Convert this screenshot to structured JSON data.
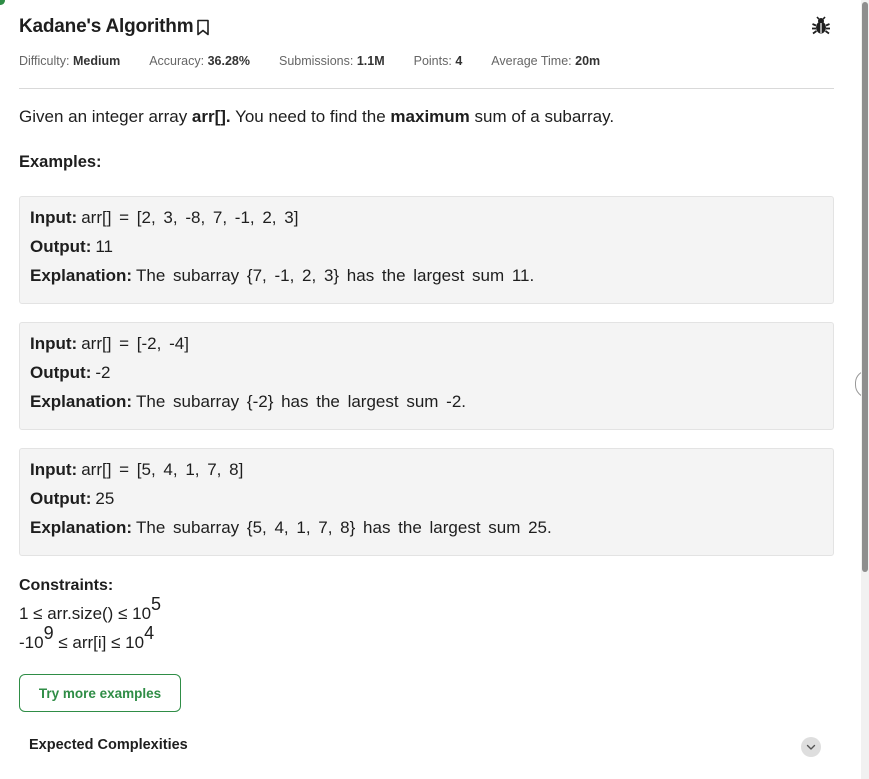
{
  "problem": {
    "title": "Kadane's Algorithm",
    "meta": [
      {
        "label": "Difficulty:",
        "value": "Medium"
      },
      {
        "label": "Accuracy:",
        "value": "36.28%"
      },
      {
        "label": "Submissions:",
        "value": "1.1M"
      },
      {
        "label": "Points:",
        "value": "4"
      },
      {
        "label": "Average Time:",
        "value": "20m"
      }
    ],
    "statement": {
      "p1": "Given an integer array ",
      "b1": "arr[].",
      "p2": " You need to find the ",
      "b2": "maximum",
      "p3": " sum of a subarray."
    },
    "examples_heading": "Examples:",
    "examples": [
      {
        "input_label": "Input:",
        "input": "arr[] = [2, 3, -8, 7, -1, 2, 3]",
        "output_label": "Output:",
        "output": "11",
        "explanation_label": "Explanation:",
        "explanation": "The subarray {7, -1, 2, 3} has the largest sum 11."
      },
      {
        "input_label": "Input:",
        "input": "arr[] = [-2, -4]",
        "output_label": "Output:",
        "output": "-2",
        "explanation_label": "Explanation:",
        "explanation": "The subarray {-2} has the largest sum -2."
      },
      {
        "input_label": "Input:",
        "input": "arr[] = [5, 4, 1, 7, 8]",
        "output_label": "Output:",
        "output": "25",
        "explanation_label": "Explanation:",
        "explanation": "The subarray {5, 4, 1, 7, 8} has the largest sum 25."
      }
    ],
    "constraints_heading": "Constraints:",
    "constraints": [
      {
        "pre": "1 ≤ arr.size() ≤ 10",
        "sup": "5",
        "post": ""
      },
      {
        "pre": "-10",
        "sup": "9",
        "post": " ≤ arr[i] ≤ 10",
        "sup2": "4"
      }
    ],
    "try_button": "Try more examples",
    "complexities_heading": "Expected Complexities"
  },
  "icons": {
    "bookmark": "bookmark-icon",
    "bug": "bug-icon",
    "chevron": "chevron-down-icon",
    "collapse": "collapse-left-icon"
  },
  "colors": {
    "accent": "#2f8d46",
    "example_bg": "#f4f4f4"
  }
}
